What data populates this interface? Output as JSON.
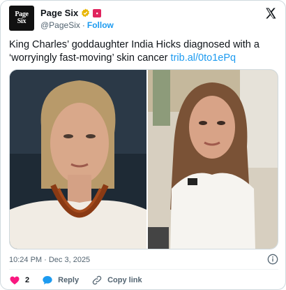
{
  "account": {
    "name": "Page Six",
    "handle": "@PageSix",
    "separator": "·",
    "follow_label": "Follow",
    "avatar_line1": "Page",
    "avatar_line2": "Six"
  },
  "tweet": {
    "text": "King Charles’ goddaughter India Hicks diagnosed with a ‘worryingly fast-moving’ skin cancer ",
    "link": "trib.al/0to1ePq",
    "timestamp": "10:24 PM · Dec 3, 2025"
  },
  "actions": {
    "like_count": "2",
    "reply_label": "Reply",
    "copy_link_label": "Copy link"
  },
  "colors": {
    "accent": "#1d9bf0",
    "like": "#f91880",
    "muted": "#536471"
  },
  "icons": [
    "verified-badge-icon",
    "notification-icon",
    "x-logo-icon",
    "info-icon",
    "heart-icon",
    "reply-icon",
    "link-icon"
  ]
}
